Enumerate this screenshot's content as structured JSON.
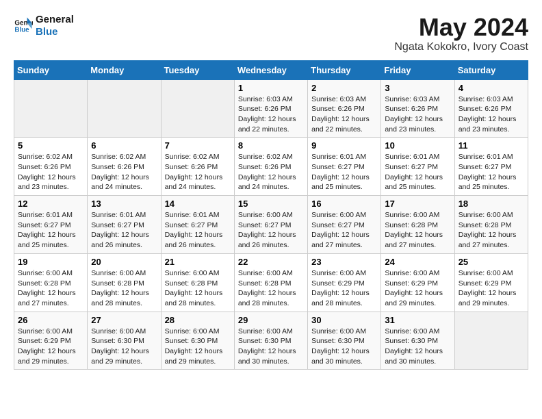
{
  "header": {
    "logo_line1": "General",
    "logo_line2": "Blue",
    "title": "May 2024",
    "subtitle": "Ngata Kokokro, Ivory Coast"
  },
  "calendar": {
    "days_of_week": [
      "Sunday",
      "Monday",
      "Tuesday",
      "Wednesday",
      "Thursday",
      "Friday",
      "Saturday"
    ],
    "weeks": [
      [
        {
          "day": "",
          "info": ""
        },
        {
          "day": "",
          "info": ""
        },
        {
          "day": "",
          "info": ""
        },
        {
          "day": "1",
          "info": "Sunrise: 6:03 AM\nSunset: 6:26 PM\nDaylight: 12 hours\nand 22 minutes."
        },
        {
          "day": "2",
          "info": "Sunrise: 6:03 AM\nSunset: 6:26 PM\nDaylight: 12 hours\nand 22 minutes."
        },
        {
          "day": "3",
          "info": "Sunrise: 6:03 AM\nSunset: 6:26 PM\nDaylight: 12 hours\nand 23 minutes."
        },
        {
          "day": "4",
          "info": "Sunrise: 6:03 AM\nSunset: 6:26 PM\nDaylight: 12 hours\nand 23 minutes."
        }
      ],
      [
        {
          "day": "5",
          "info": "Sunrise: 6:02 AM\nSunset: 6:26 PM\nDaylight: 12 hours\nand 23 minutes."
        },
        {
          "day": "6",
          "info": "Sunrise: 6:02 AM\nSunset: 6:26 PM\nDaylight: 12 hours\nand 24 minutes."
        },
        {
          "day": "7",
          "info": "Sunrise: 6:02 AM\nSunset: 6:26 PM\nDaylight: 12 hours\nand 24 minutes."
        },
        {
          "day": "8",
          "info": "Sunrise: 6:02 AM\nSunset: 6:26 PM\nDaylight: 12 hours\nand 24 minutes."
        },
        {
          "day": "9",
          "info": "Sunrise: 6:01 AM\nSunset: 6:27 PM\nDaylight: 12 hours\nand 25 minutes."
        },
        {
          "day": "10",
          "info": "Sunrise: 6:01 AM\nSunset: 6:27 PM\nDaylight: 12 hours\nand 25 minutes."
        },
        {
          "day": "11",
          "info": "Sunrise: 6:01 AM\nSunset: 6:27 PM\nDaylight: 12 hours\nand 25 minutes."
        }
      ],
      [
        {
          "day": "12",
          "info": "Sunrise: 6:01 AM\nSunset: 6:27 PM\nDaylight: 12 hours\nand 25 minutes."
        },
        {
          "day": "13",
          "info": "Sunrise: 6:01 AM\nSunset: 6:27 PM\nDaylight: 12 hours\nand 26 minutes."
        },
        {
          "day": "14",
          "info": "Sunrise: 6:01 AM\nSunset: 6:27 PM\nDaylight: 12 hours\nand 26 minutes."
        },
        {
          "day": "15",
          "info": "Sunrise: 6:00 AM\nSunset: 6:27 PM\nDaylight: 12 hours\nand 26 minutes."
        },
        {
          "day": "16",
          "info": "Sunrise: 6:00 AM\nSunset: 6:27 PM\nDaylight: 12 hours\nand 27 minutes."
        },
        {
          "day": "17",
          "info": "Sunrise: 6:00 AM\nSunset: 6:28 PM\nDaylight: 12 hours\nand 27 minutes."
        },
        {
          "day": "18",
          "info": "Sunrise: 6:00 AM\nSunset: 6:28 PM\nDaylight: 12 hours\nand 27 minutes."
        }
      ],
      [
        {
          "day": "19",
          "info": "Sunrise: 6:00 AM\nSunset: 6:28 PM\nDaylight: 12 hours\nand 27 minutes."
        },
        {
          "day": "20",
          "info": "Sunrise: 6:00 AM\nSunset: 6:28 PM\nDaylight: 12 hours\nand 28 minutes."
        },
        {
          "day": "21",
          "info": "Sunrise: 6:00 AM\nSunset: 6:28 PM\nDaylight: 12 hours\nand 28 minutes."
        },
        {
          "day": "22",
          "info": "Sunrise: 6:00 AM\nSunset: 6:28 PM\nDaylight: 12 hours\nand 28 minutes."
        },
        {
          "day": "23",
          "info": "Sunrise: 6:00 AM\nSunset: 6:29 PM\nDaylight: 12 hours\nand 28 minutes."
        },
        {
          "day": "24",
          "info": "Sunrise: 6:00 AM\nSunset: 6:29 PM\nDaylight: 12 hours\nand 29 minutes."
        },
        {
          "day": "25",
          "info": "Sunrise: 6:00 AM\nSunset: 6:29 PM\nDaylight: 12 hours\nand 29 minutes."
        }
      ],
      [
        {
          "day": "26",
          "info": "Sunrise: 6:00 AM\nSunset: 6:29 PM\nDaylight: 12 hours\nand 29 minutes."
        },
        {
          "day": "27",
          "info": "Sunrise: 6:00 AM\nSunset: 6:30 PM\nDaylight: 12 hours\nand 29 minutes."
        },
        {
          "day": "28",
          "info": "Sunrise: 6:00 AM\nSunset: 6:30 PM\nDaylight: 12 hours\nand 29 minutes."
        },
        {
          "day": "29",
          "info": "Sunrise: 6:00 AM\nSunset: 6:30 PM\nDaylight: 12 hours\nand 30 minutes."
        },
        {
          "day": "30",
          "info": "Sunrise: 6:00 AM\nSunset: 6:30 PM\nDaylight: 12 hours\nand 30 minutes."
        },
        {
          "day": "31",
          "info": "Sunrise: 6:00 AM\nSunset: 6:30 PM\nDaylight: 12 hours\nand 30 minutes."
        },
        {
          "day": "",
          "info": ""
        }
      ]
    ]
  }
}
